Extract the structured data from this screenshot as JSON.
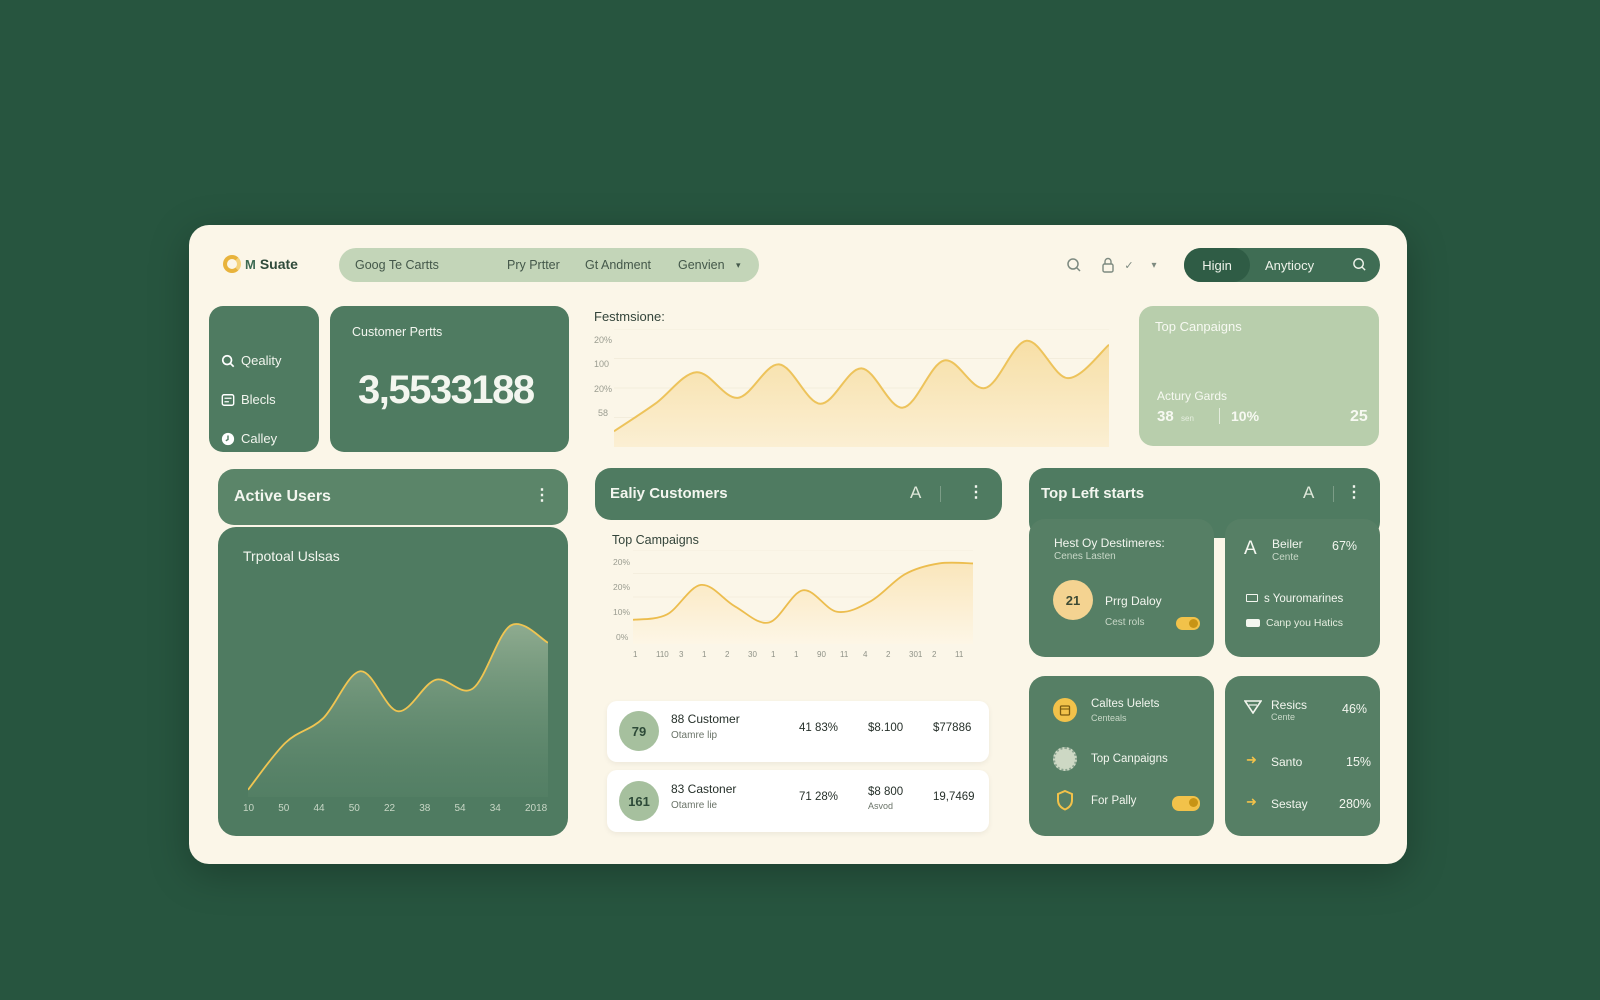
{
  "header": {
    "logo_text": "Suate",
    "logo_mark_letter": "M",
    "nav": [
      "Goog Te Cartts",
      "Pry Prtter",
      "Gt Andment",
      "Genvien"
    ],
    "seg_active": "Higin",
    "seg_other": "Anytiocy"
  },
  "sidebar": {
    "items": [
      {
        "label": "Qeality",
        "icon": "search-icon"
      },
      {
        "label": "Blecls",
        "icon": "grid-icon"
      },
      {
        "label": "Calley",
        "icon": "clock-icon"
      }
    ]
  },
  "metric": {
    "label": "Customer Pertts",
    "value": "3,5533188"
  },
  "top_chart": {
    "title": "Festmsione:",
    "ytick_labels": [
      "20%",
      "100",
      "20%",
      "58"
    ]
  },
  "campaign_card": {
    "title": "Top Canpaigns",
    "subtitle": "Actury Gards",
    "stat1": "38",
    "stat1_unit": "sen",
    "stat2": "10%",
    "stat3": "25"
  },
  "active_users": {
    "header": "Active Users",
    "title": "Trpotoal Uslsas",
    "xtick_labels": [
      "10",
      "50",
      "44",
      "50",
      "22",
      "38",
      "54",
      "34",
      "2018"
    ]
  },
  "early_customers": {
    "header": "Ealiy Customers",
    "header_letter": "A",
    "chart_title": "Top Campaigns",
    "ytick_labels": [
      "20%",
      "20%",
      "10%",
      "0%"
    ],
    "xtick_labels": [
      "1",
      "110",
      "3",
      "1",
      "2",
      "30",
      "1",
      "1",
      "90",
      "11",
      "4",
      "2",
      "301",
      "2",
      "11"
    ],
    "rows": [
      {
        "badge": "79",
        "name": "88 Customer",
        "sub": "Otamre lip",
        "pct": "41 83%",
        "amt": "$8.100",
        "amt_sub": "",
        "total": "$77886"
      },
      {
        "badge": "161",
        "name": "83 Castoner",
        "sub": "Otamre lie",
        "pct": "71 28%",
        "amt": "$8 800",
        "amt_sub": "Asvod",
        "total": "19,7469"
      }
    ]
  },
  "top_left": {
    "header": "Top Left starts",
    "header_letter": "A",
    "card1": {
      "title": "Hest Oy Destimeres:",
      "sub": "Cenes Lasten",
      "badge": "21",
      "item": "Prrg Daloy",
      "item_sub": "Cest rols"
    },
    "card2": {
      "icon_label": "A",
      "title": "Beiler",
      "sub": "Cente",
      "pct": "67%",
      "line1": "s Youromarines",
      "line2": "Canp you Hatics"
    },
    "card3": {
      "items": [
        {
          "label": "Caltes Uelets",
          "sub": "Centeals"
        },
        {
          "label": "Top Canpaigns",
          "sub": ""
        },
        {
          "label": "For Pally",
          "sub": ""
        }
      ]
    },
    "card4": {
      "items": [
        {
          "label": "Resics",
          "sub": "Cente",
          "pct": "46%"
        },
        {
          "label": "Santo",
          "sub": "",
          "pct": "15%"
        },
        {
          "label": "Sestay",
          "sub": "",
          "pct": "280%"
        }
      ]
    }
  },
  "colors": {
    "bg": "#27553f",
    "panel": "#fbf6e8",
    "card_green": "#4f7b61",
    "accent": "#f2c24a",
    "light_green": "#b8ceac"
  },
  "chart_data": [
    {
      "type": "area",
      "title": "Festmsione:",
      "x": [
        0,
        1,
        2,
        3,
        4,
        5,
        6,
        7,
        8,
        9,
        10,
        11,
        12
      ],
      "values": [
        8,
        22,
        38,
        25,
        42,
        22,
        40,
        20,
        44,
        30,
        54,
        35,
        52
      ],
      "ylim": [
        0,
        60
      ]
    },
    {
      "type": "area",
      "title": "Trpotoal Uslsas",
      "categories": [
        "10",
        "50",
        "44",
        "50",
        "22",
        "38",
        "54",
        "34",
        "2018"
      ],
      "values": [
        5,
        38,
        55,
        88,
        60,
        82,
        76,
        120,
        108
      ],
      "ylim": [
        0,
        140
      ]
    },
    {
      "type": "area",
      "title": "Top Campaigns",
      "x": [
        0,
        1,
        2,
        3,
        4,
        5,
        6,
        7,
        8,
        9,
        10
      ],
      "values": [
        9,
        11,
        22,
        14,
        8,
        20,
        12,
        16,
        26,
        30,
        30
      ],
      "ylim": [
        0,
        35
      ]
    }
  ]
}
